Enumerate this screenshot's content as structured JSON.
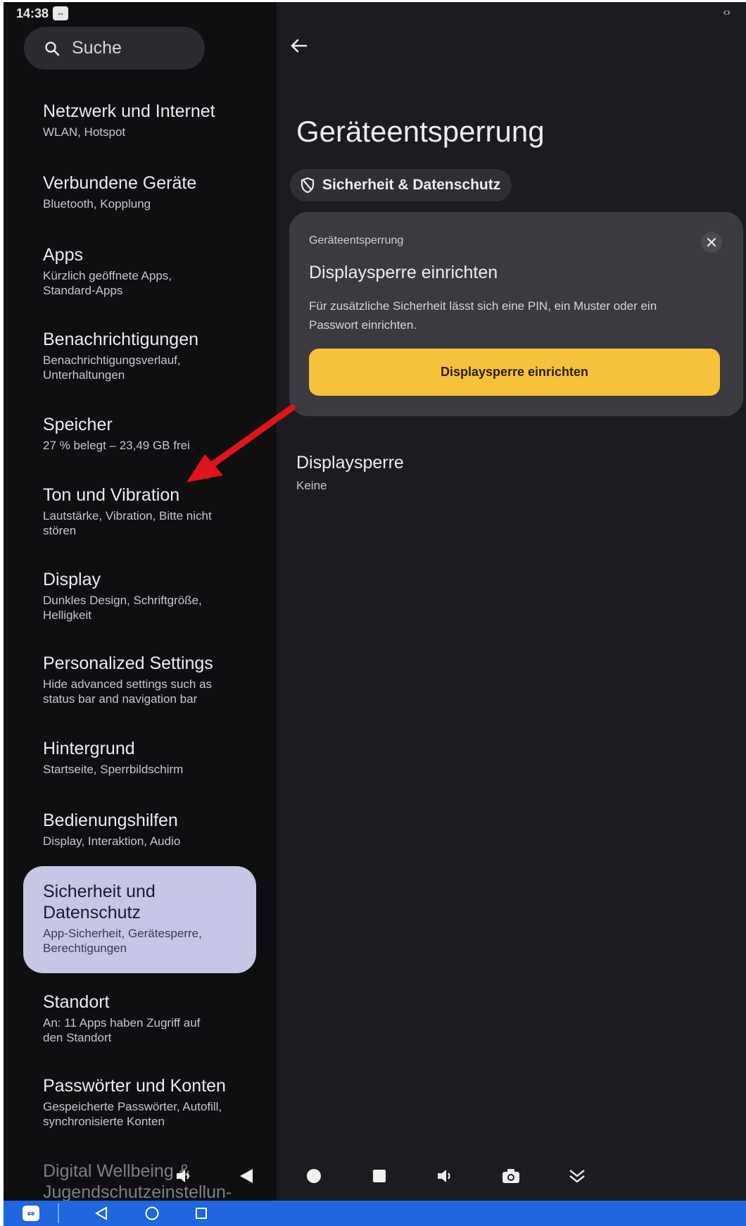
{
  "status": {
    "time": "14:38",
    "right_indicator": "‹›"
  },
  "search": {
    "label": "Suche"
  },
  "sidebar": {
    "items": [
      {
        "title": "Netzwerk und Internet",
        "subtitle": "WLAN, Hotspot"
      },
      {
        "title": "Verbundene Geräte",
        "subtitle": "Bluetooth, Kopplung"
      },
      {
        "title": "Apps",
        "subtitle": "Kürzlich geöffnete Apps, Standard-Apps"
      },
      {
        "title": "Benachrichtigungen",
        "subtitle": "Benachrichtigungsverlauf, Unterhaltungen"
      },
      {
        "title": "Speicher",
        "subtitle": "27 % belegt – 23,49 GB frei"
      },
      {
        "title": "Ton und Vibration",
        "subtitle": "Lautstärke, Vibration, Bitte nicht stören"
      },
      {
        "title": "Display",
        "subtitle": "Dunkles Design, Schriftgröße, Helligkeit"
      },
      {
        "title": "Personalized Settings",
        "subtitle": "Hide advanced settings such as status bar and navigation bar"
      },
      {
        "title": "Hintergrund",
        "subtitle": "Startseite, Sperrbildschirm"
      },
      {
        "title": "Bedienungshilfen",
        "subtitle": "Display, Interaktion, Audio"
      },
      {
        "title": "Sicherheit und Datenschutz",
        "subtitle": "App-Sicherheit, Gerätesperre, Berechtigungen"
      },
      {
        "title": "Standort",
        "subtitle": "An: 11 Apps haben Zugriff auf den Standort"
      },
      {
        "title": "Passwörter und Konten",
        "subtitle": "Gespeicherte Passwörter, Autofill, synchronisierte Konten"
      },
      {
        "title": "Digital Wellbeing & Jugendschutzeinstellun-",
        "subtitle": ""
      }
    ]
  },
  "main": {
    "page_title": "Geräteentsperrung",
    "chip_label": "Sicherheit & Datenschutz",
    "card": {
      "category": "Geräteentsperrung",
      "heading": "Displaysperre einrichten",
      "description": "Für zusätzliche Sicherheit lässt sich eine PIN, ein Muster oder ein Passwort einrichten.",
      "button_label": "Displaysperre einrichten"
    },
    "preference": {
      "title": "Displaysperre",
      "value": "Keine"
    }
  },
  "colors": {
    "accent_button": "#f6c23b",
    "selected_item": "#c7c6e6",
    "annotation_arrow": "#e0141b",
    "taskbar": "#1f66e0"
  },
  "icons": [
    "search-icon",
    "back-arrow-icon",
    "shield-icon",
    "close-icon",
    "record-icon",
    "stop-icon",
    "volume-icon",
    "camera-icon",
    "expand-icon",
    "back-nav-icon",
    "home-nav-icon",
    "recents-nav-icon",
    "remote-control-icon"
  ]
}
